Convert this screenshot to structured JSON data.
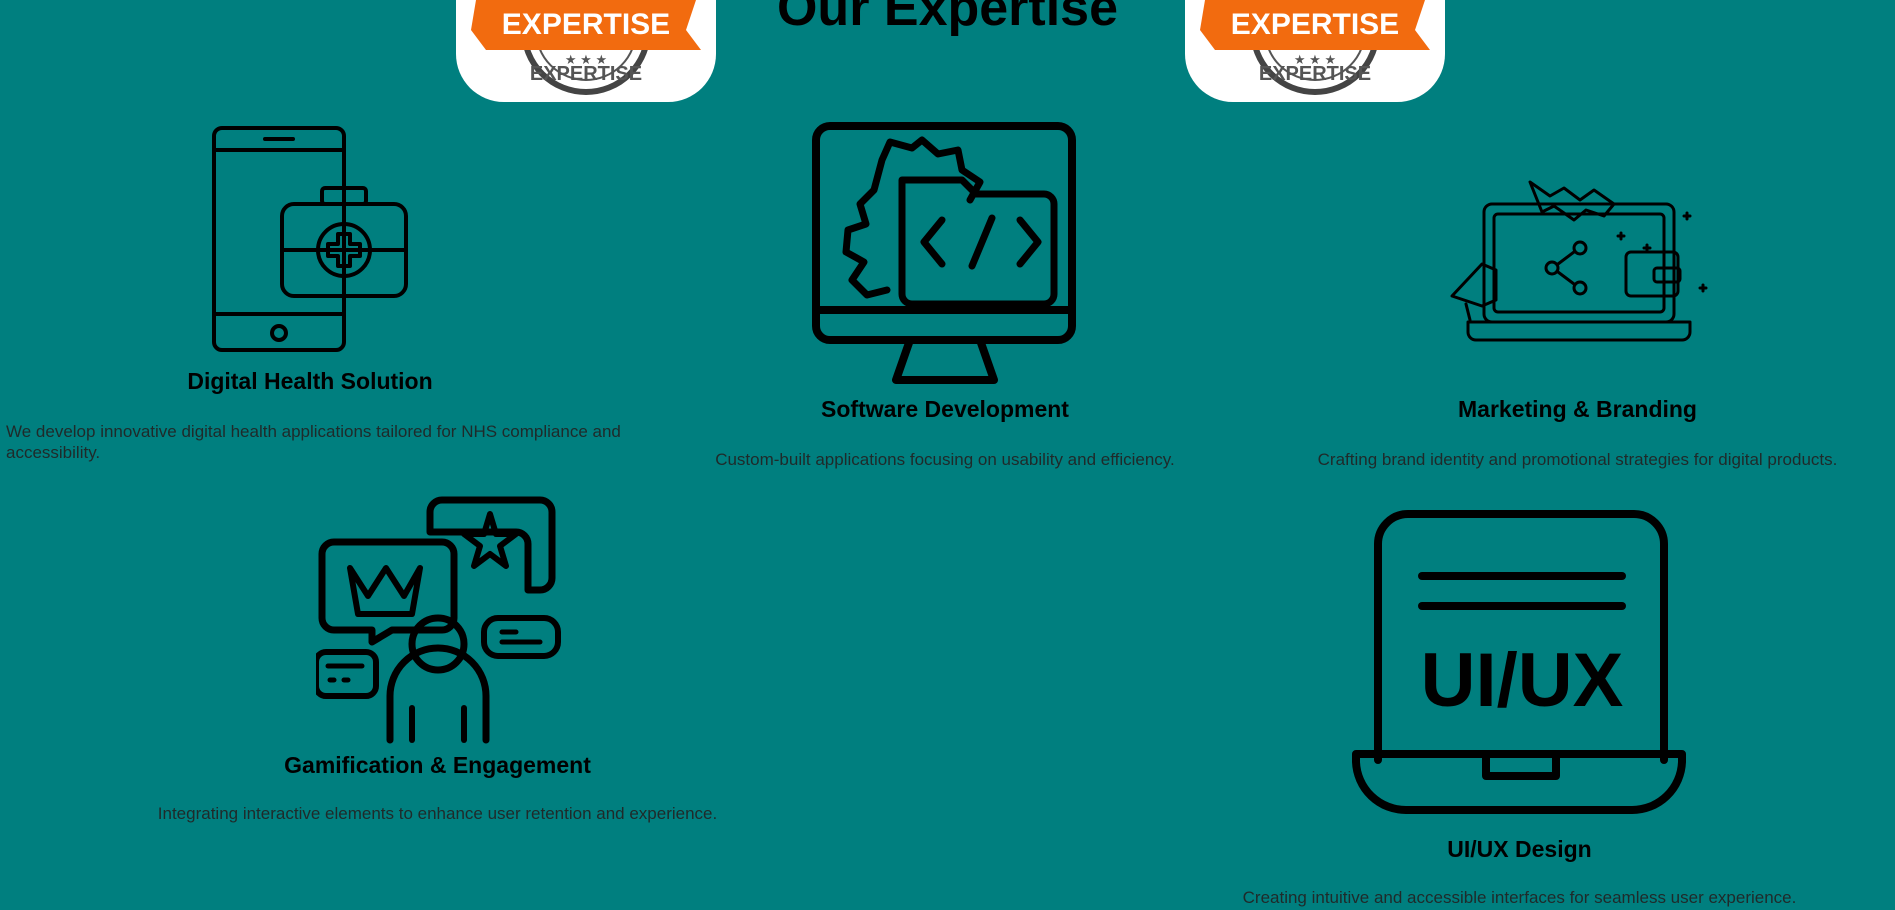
{
  "page": {
    "heading": "Our Expertise",
    "accent_bg": "#007f7f",
    "badge": {
      "text_ribbon": "EXPERTISE",
      "text_seal": "EXPERTISE",
      "ribbon_color": "#f26b0f"
    }
  },
  "services": [
    {
      "icon": "mobile-medical-kit-icon",
      "title": "Digital Health Solution",
      "description": "We develop innovative digital health applications tailored for NHS compliance and accessibility."
    },
    {
      "icon": "monitor-code-gear-icon",
      "title": "Software Development",
      "description": "Custom-built applications focusing on usability and efficiency."
    },
    {
      "icon": "laptop-marketing-handshake-icon",
      "title": "Marketing & Branding",
      "description": "Crafting brand identity and promotional strategies for digital products."
    },
    {
      "icon": "user-chat-badges-icon",
      "title": "Gamification & Engagement",
      "description": "Integrating interactive elements to enhance user retention and experience."
    },
    {
      "icon": "laptop-uiux-icon",
      "title": "UI/UX Design",
      "description": "Creating intuitive and accessible interfaces for seamless user experience.",
      "icon_text": "UI/UX"
    }
  ]
}
